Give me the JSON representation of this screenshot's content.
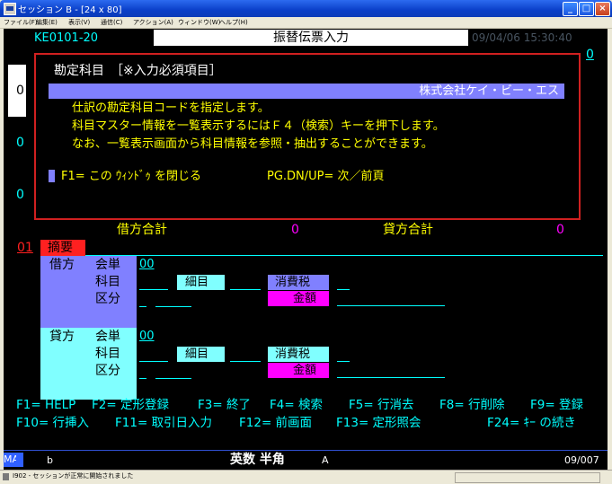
{
  "window": {
    "title": "セッション B - [24 x 80]",
    "buttons": {
      "minimize": "_",
      "maximize": "□",
      "close": "×"
    }
  },
  "menu": [
    "ファイル(F)",
    "編集(E)",
    "表示(V)",
    "通信(C)",
    "アクション(A)",
    "ウィンドウ(W)",
    "ヘルプ(H)"
  ],
  "screen": {
    "program_id": "KE0101-20",
    "title": "振替伝票入力",
    "datetime": "09/04/06 15:30:40",
    "page_indicator": "0",
    "side_values": [
      "0",
      "0",
      "0"
    ],
    "help": {
      "heading": "勘定科目　［※入力必須項目］",
      "company": "株式会社ケイ・ビー・エス",
      "lines": [
        "仕訳の勘定科目コードを指定します。",
        "科目マスター情報を一覧表示するにはＦ４（検索）キーを押下します。",
        "なお、一覧表示画面から科目情報を参照・抽出することができます。"
      ],
      "close_hint": "F1= この ｳｨﾝﾄﾞｩ を閉じる",
      "page_hint": "PG.DN/UP= 次／前頁"
    },
    "totals": {
      "debit_label": "借方合計",
      "debit_value": "0",
      "credit_label": "貸方合計",
      "credit_value": "0"
    },
    "line_no": "01",
    "summary_label": "摘要",
    "entries": [
      {
        "side": "借方",
        "labels": [
          "会単",
          "科目",
          "区分"
        ],
        "unit_value": "00",
        "detail": "細目",
        "tax": "消費税",
        "amount": "金額"
      },
      {
        "side": "貸方",
        "labels": [
          "会単",
          "科目",
          "区分"
        ],
        "unit_value": "00",
        "detail": "細目",
        "tax": "消費税",
        "amount": "金額"
      }
    ],
    "fkeys_row1": [
      "F1= HELP",
      "F2= 定形登録",
      "F3= 終了",
      "F4= 検索",
      "F5= 行消去",
      "F8= 行削除",
      "F9= 登録"
    ],
    "fkeys_row2": [
      "F10= 行挿入",
      "F11= 取引日入力",
      "F12= 前画面",
      "F13= 定形照会",
      "F24= ｷｰ の続き"
    ],
    "oia": {
      "ma": "MA",
      "b": "b",
      "mode": "英数 半角",
      "a": "A",
      "position": "09/007"
    }
  },
  "status": {
    "message": "I902 - セッションが正常に開始されました"
  },
  "colors": {
    "terminal_bg": "#000000",
    "cyan": "#00ffff",
    "yellow": "#ffff00",
    "green": "#00ff00",
    "magenta": "#ff00ff",
    "red": "#ff2020",
    "debit_block": "#8080ff",
    "credit_block": "#80ffff",
    "detail_box": "#80ffff",
    "tax_box": "#8080ff",
    "amount_box": "#ff00ff",
    "help_band": "#8080ff"
  }
}
